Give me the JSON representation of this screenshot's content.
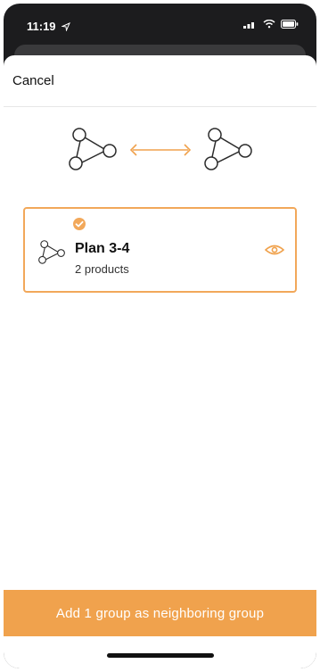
{
  "status": {
    "time": "11:19",
    "location_icon": "location-arrow-icon",
    "icons": [
      "signal-icon",
      "wifi-icon",
      "battery-icon"
    ]
  },
  "header": {
    "cancel_label": "Cancel"
  },
  "graphic": {
    "left_icon": "group-graph-icon",
    "arrow_icon": "double-arrow-icon",
    "right_icon": "group-graph-icon",
    "accent_color": "#f0a24d"
  },
  "card": {
    "selected": true,
    "check_icon": "check-circle-icon",
    "icon": "group-graph-icon",
    "title": "Plan 3-4",
    "subtitle": "2 products",
    "eye_icon": "eye-icon"
  },
  "footer": {
    "button_label": "Add 1 group as neighboring group"
  },
  "colors": {
    "accent": "#f0a24d",
    "card_border": "#f2a85a",
    "status_bar_bg": "#1c1c1e"
  }
}
